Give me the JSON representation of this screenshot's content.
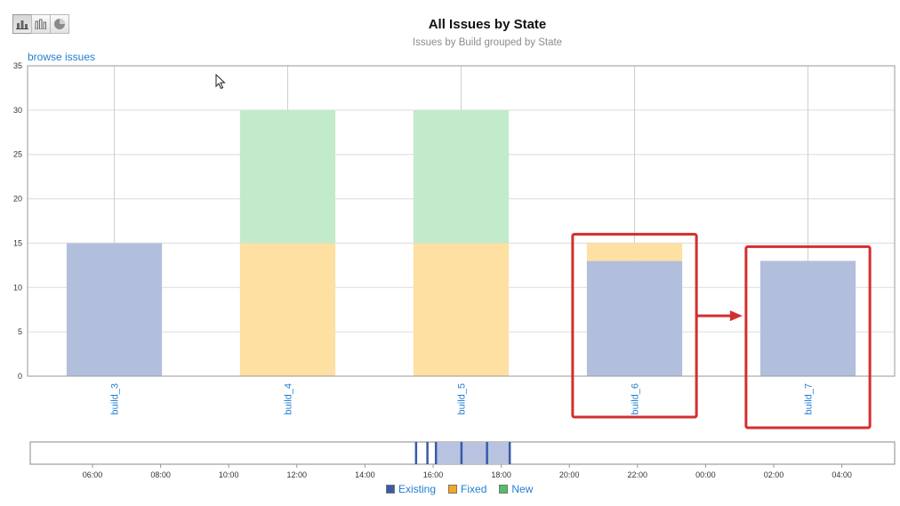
{
  "toolbar": {
    "buttons": [
      {
        "icon": "stacked-bar-chart-icon",
        "active": true
      },
      {
        "icon": "bar-chart-icon",
        "active": false
      },
      {
        "icon": "pie-chart-icon",
        "active": false
      }
    ]
  },
  "browse_link": "browse issues",
  "chart_data": {
    "type": "bar",
    "stacked": true,
    "title": "All Issues by State",
    "subtitle": "Issues by Build grouped by State",
    "categories": [
      "build_3",
      "build_4",
      "build_5",
      "build_6",
      "build_7"
    ],
    "series": [
      {
        "name": "Existing",
        "color": "#b2bfdc",
        "values": [
          15,
          0,
          0,
          13,
          13
        ]
      },
      {
        "name": "Fixed",
        "color": "#fde0a2",
        "values": [
          0,
          15,
          15,
          2,
          0
        ]
      },
      {
        "name": "New",
        "color": "#c1ebcb",
        "values": [
          0,
          15,
          15,
          0,
          0
        ]
      }
    ],
    "ylim": [
      0,
      35
    ],
    "yticks": [
      "0",
      "5",
      "10",
      "15",
      "20",
      "25",
      "30",
      "35"
    ],
    "grid": true,
    "legend": "bottom",
    "navigator": {
      "time_labels": [
        "06:00",
        "08:00",
        "10:00",
        "12:00",
        "14:00",
        "16:00",
        "18:00",
        "20:00",
        "22:00",
        "00:00",
        "02:00",
        "04:00"
      ],
      "markers": [
        "15:30",
        "15:50",
        "16:05",
        "16:50",
        "17:35",
        "18:15"
      ],
      "range": [
        "16:05",
        "18:15"
      ]
    },
    "annotations": {
      "highlight_boxes": [
        "build_6",
        "build_7"
      ],
      "arrow": {
        "from": "build_6",
        "to": "build_7",
        "color": "#d32f2f"
      }
    }
  },
  "colors": {
    "existing": "#b2bfdc",
    "fixed": "#fde0a2",
    "new": "#c1ebcb",
    "link": "#1f7fd1",
    "navigator_marker": "#3a5aa8",
    "annotation": "#d32f2f"
  }
}
